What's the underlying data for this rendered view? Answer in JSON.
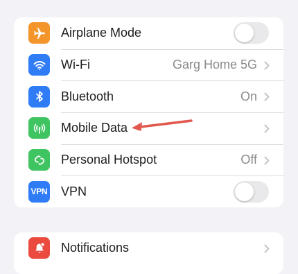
{
  "settings_group": {
    "items": [
      {
        "label": "Airplane Mode",
        "icon": "airplane-icon",
        "color": "#f3952b",
        "control": "toggle",
        "toggle_on": false
      },
      {
        "label": "Wi-Fi",
        "icon": "wifi-icon",
        "color": "#2f7cf6",
        "value": "Garg Home 5G",
        "control": "chevron"
      },
      {
        "label": "Bluetooth",
        "icon": "bluetooth-icon",
        "color": "#2f7cf6",
        "value": "On",
        "control": "chevron"
      },
      {
        "label": "Mobile Data",
        "icon": "antenna-icon",
        "color": "#3fc462",
        "control": "chevron"
      },
      {
        "label": "Personal Hotspot",
        "icon": "hotspot-icon",
        "color": "#3fc462",
        "value": "Off",
        "control": "chevron"
      },
      {
        "label": "VPN",
        "icon": "vpn-icon",
        "icon_text": "VPN",
        "color": "#2f7cf6",
        "control": "toggle",
        "toggle_on": false
      }
    ]
  },
  "notifications_group": {
    "items": [
      {
        "label": "Notifications",
        "icon": "notifications-icon",
        "color": "#eb4b3f",
        "control": "chevron"
      }
    ]
  },
  "annotation": {
    "arrow_color": "#e0584e",
    "points_to": "Mobile Data"
  }
}
